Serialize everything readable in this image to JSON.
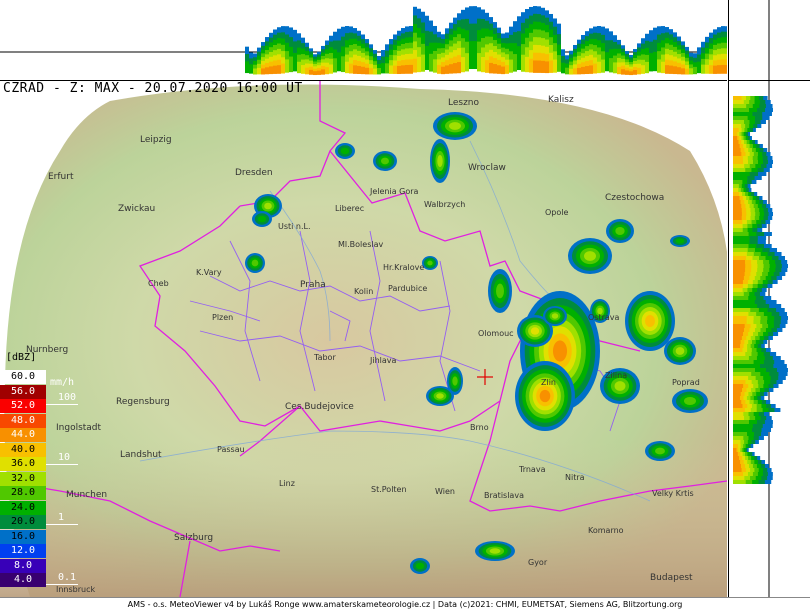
{
  "title": "CZRAD - Z: MAX - 20.07.2020 16:00 UT",
  "footer": "AMS - o.s. MeteoViewer v4 by Lukáš Ronge www.amaterskameteorologie.cz | Data (c)2021: CHMI, EUMETSAT, Siemens AG, Blitzortung.org",
  "legend": {
    "unit": "[dBZ]",
    "rate_unit": "mm/h",
    "rows": [
      {
        "label": "60.0",
        "color": "#ffffff",
        "text": "#000000"
      },
      {
        "label": "56.0",
        "color": "#a00000",
        "text": "#ffffff"
      },
      {
        "label": "52.0",
        "color": "#fa0000",
        "text": "#ffffff"
      },
      {
        "label": "48.0",
        "color": "#f84800",
        "text": "#ffffff"
      },
      {
        "label": "44.0",
        "color": "#f89000",
        "text": "#ffffff"
      },
      {
        "label": "40.0",
        "color": "#f8c000",
        "text": "#000000"
      },
      {
        "label": "36.0",
        "color": "#e0e000",
        "text": "#000000"
      },
      {
        "label": "32.0",
        "color": "#a0e000",
        "text": "#000000"
      },
      {
        "label": "28.0",
        "color": "#50c800",
        "text": "#000000"
      },
      {
        "label": "24.0",
        "color": "#00b000",
        "text": "#000000"
      },
      {
        "label": "20.0",
        "color": "#008c3c",
        "text": "#000000"
      },
      {
        "label": "16.0",
        "color": "#0070c8",
        "text": "#000000"
      },
      {
        "label": "12.0",
        "color": "#0040f0",
        "text": "#ffffff"
      },
      {
        "label": "8.0",
        "color": "#3800b8",
        "text": "#ffffff"
      },
      {
        "label": "4.0",
        "color": "#380070",
        "text": "#ffffff"
      }
    ],
    "rates": [
      {
        "label": "100"
      },
      {
        "label": "10"
      },
      {
        "label": "1"
      },
      {
        "label": "0.1"
      }
    ]
  },
  "cities": [
    {
      "name": "Leipzig"
    },
    {
      "name": "Erfurt"
    },
    {
      "name": "Dresden"
    },
    {
      "name": "Zwickau"
    },
    {
      "name": "Leszno"
    },
    {
      "name": "Kalisz"
    },
    {
      "name": "Wroclaw"
    },
    {
      "name": "Jelenia Gora"
    },
    {
      "name": "Walbrzych"
    },
    {
      "name": "Opole"
    },
    {
      "name": "Czestochowa"
    },
    {
      "name": "Usti n.L."
    },
    {
      "name": "Liberec"
    },
    {
      "name": "Ml.Boleslav"
    },
    {
      "name": "Hr.Kralove"
    },
    {
      "name": "K.Vary"
    },
    {
      "name": "Praha"
    },
    {
      "name": "Kolin"
    },
    {
      "name": "Pardubice"
    },
    {
      "name": "Cheb"
    },
    {
      "name": "Plzen"
    },
    {
      "name": "Olomouc"
    },
    {
      "name": "Tabor"
    },
    {
      "name": "Jihlava"
    },
    {
      "name": "Nurnberg"
    },
    {
      "name": "Regensburg"
    },
    {
      "name": "Ces.Budejovice"
    },
    {
      "name": "Ingolstadt"
    },
    {
      "name": "Brno"
    },
    {
      "name": "Zlin"
    },
    {
      "name": "Passau"
    },
    {
      "name": "Landshut"
    },
    {
      "name": "Trnava"
    },
    {
      "name": "Nitra"
    },
    {
      "name": "Linz"
    },
    {
      "name": "Munchen"
    },
    {
      "name": "St.Polten"
    },
    {
      "name": "Wien"
    },
    {
      "name": "Bratislava"
    },
    {
      "name": "Salzburg"
    },
    {
      "name": "Komarno"
    },
    {
      "name": "Gyor"
    },
    {
      "name": "Budapest"
    },
    {
      "name": "Innsbruck"
    },
    {
      "name": "Velky Krtis"
    },
    {
      "name": "Poprad"
    },
    {
      "name": "Zilina"
    },
    {
      "name": "Ostrava"
    }
  ],
  "colors": {
    "border": "#e020e0",
    "regions": "#8a4cff",
    "terrain_low": "#c8dca0",
    "terrain_high": "#c8a878"
  }
}
